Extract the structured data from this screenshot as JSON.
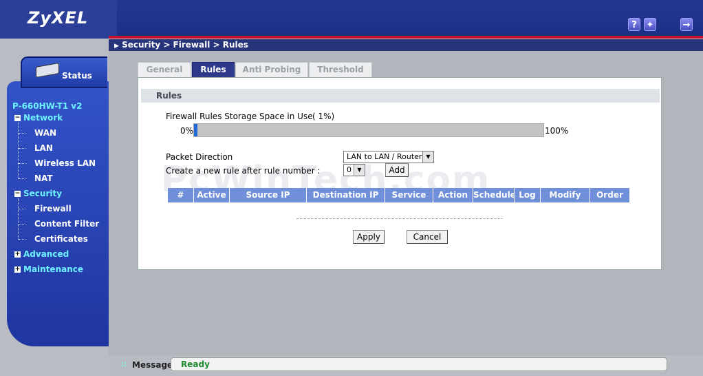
{
  "header": {
    "logo": "ZyXEL",
    "help_icon": "question-icon",
    "wizard_icon": "wizard-icon",
    "logout_icon": "logout-icon"
  },
  "sidebar": {
    "status_label": "Status",
    "model": "P-660HW-T1 v2",
    "items": [
      {
        "label": "Network",
        "type": "group"
      },
      {
        "label": "WAN",
        "type": "child"
      },
      {
        "label": "LAN",
        "type": "child"
      },
      {
        "label": "Wireless LAN",
        "type": "child"
      },
      {
        "label": "NAT",
        "type": "child"
      },
      {
        "label": "Security",
        "type": "group"
      },
      {
        "label": "Firewall",
        "type": "child"
      },
      {
        "label": "Content Filter",
        "type": "child"
      },
      {
        "label": "Certificates",
        "type": "child"
      },
      {
        "label": "Advanced",
        "type": "group"
      },
      {
        "label": "Maintenance",
        "type": "group"
      }
    ]
  },
  "breadcrumb": "Security > Firewall > Rules",
  "tabs": [
    {
      "label": "General"
    },
    {
      "label": "Rules"
    },
    {
      "label": "Anti Probing"
    },
    {
      "label": "Threshold"
    }
  ],
  "panel": {
    "title": "Rules",
    "storage_label": "Firewall Rules Storage Space in Use",
    "storage_pct_text": "( 1%)",
    "storage_used_pct": 1,
    "bar_min": "0%",
    "bar_max": "100%",
    "direction_label": "Packet Direction",
    "direction_value": "LAN to LAN / Router",
    "create_label": "Create a new rule after rule number :",
    "rule_number": "0",
    "add_label": "Add",
    "columns": [
      "#",
      "Active",
      "Source IP",
      "Destination IP",
      "Service",
      "Action",
      "Schedule",
      "Log",
      "Modify",
      "Order"
    ],
    "apply_label": "Apply",
    "cancel_label": "Cancel",
    "watermark": "PcWinTech.com"
  },
  "footer": {
    "message_label": "Message",
    "message_value": "Ready"
  }
}
